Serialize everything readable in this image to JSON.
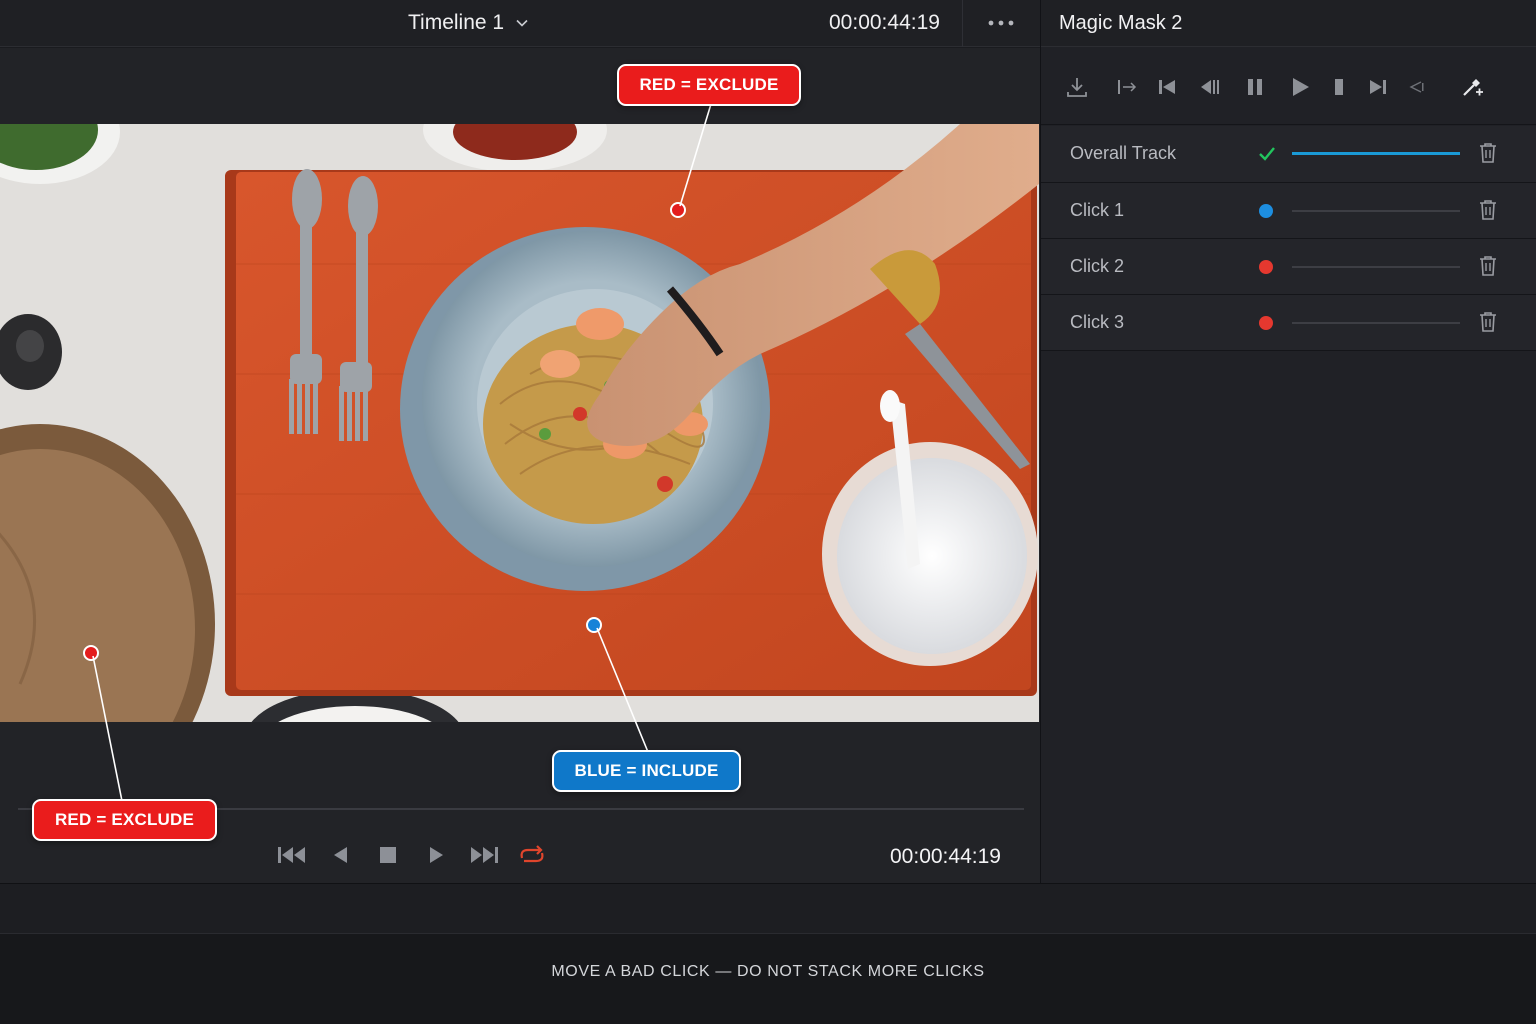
{
  "viewer": {
    "timeline_title": "Timeline 1",
    "header_timecode": "00:00:44:19",
    "transport_timecode": "00:00:44:19",
    "more_icon": "ellipsis-icon",
    "dropdown_icon": "chevron-down-icon"
  },
  "callouts": {
    "top_exclude": "RED = EXCLUDE",
    "bottom_exclude": "RED = EXCLUDE",
    "include": "BLUE = INCLUDE"
  },
  "transport": {
    "buttons": [
      "skip-to-start-icon",
      "play-reverse-icon",
      "stop-icon",
      "play-icon",
      "skip-to-end-icon",
      "loop-icon"
    ],
    "loop_color": "#e0452c"
  },
  "panel": {
    "title": "Magic Mask 2",
    "toolbar": [
      "download-icon",
      "track-backward-frame-icon",
      "previous-keyframe-icon",
      "track-reverse-icon",
      "pause-icon",
      "track-forward-icon",
      "stop-tracking-icon",
      "next-keyframe-icon",
      "track-forward-frame-icon",
      "eyedropper-add-icon"
    ],
    "tracks": [
      {
        "label": "Overall Track",
        "marker": "check",
        "color": "#22c55e"
      },
      {
        "label": "Click 1",
        "marker": "dot",
        "color": "#1d8ee0"
      },
      {
        "label": "Click 2",
        "marker": "dot",
        "color": "#e5382f"
      },
      {
        "label": "Click 3",
        "marker": "dot",
        "color": "#e5382f"
      }
    ]
  },
  "colors": {
    "exclude_red": "#ea1c1c",
    "include_blue": "#0f78c9",
    "track_active": "#1a9ad6"
  },
  "footer": {
    "message": "MOVE A BAD CLICK — DO NOT STACK MORE CLICKS"
  }
}
